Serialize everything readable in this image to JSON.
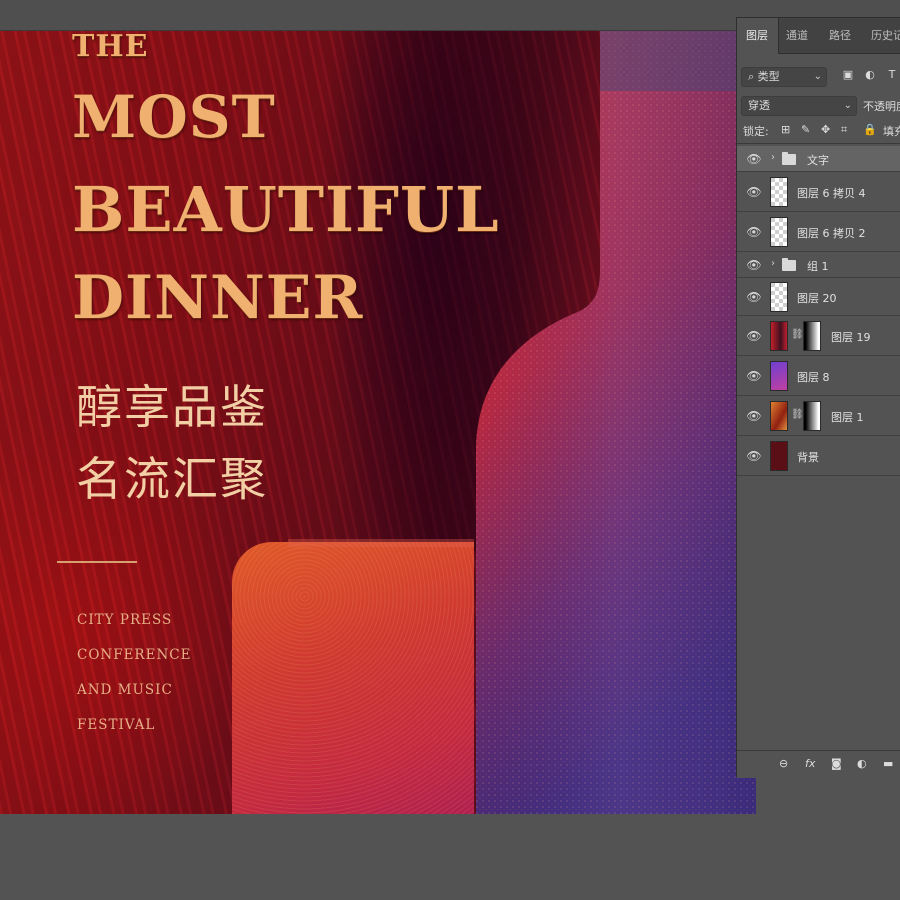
{
  "poster": {
    "title_line1": "THE",
    "title_line2": "MOST",
    "title_line3": "BEAUTIFUL",
    "title_line4": "DINNER",
    "chinese_line1": "醇享品鉴",
    "chinese_line2": "名流汇聚",
    "subtitle_lines": [
      "CITY PRESS",
      "CONFERENCE",
      "AND MUSIC",
      "FESTIVAL"
    ]
  },
  "layers_panel": {
    "tabs": [
      "图层",
      "通道",
      "路径",
      "历史记"
    ],
    "active_tab": "图层",
    "filter_kind": "类型",
    "filter_icons": [
      "image-filter-icon",
      "adjustment-filter-icon",
      "type-filter-icon"
    ],
    "type_filter_glyph": "T",
    "blend_mode": "穿透",
    "opacity_label": "不透明度",
    "lock_label": "锁定:",
    "fill_label": "填充",
    "layers": [
      {
        "name": "文字",
        "kind": "group",
        "selected": true
      },
      {
        "name": "图层 6 拷贝 4",
        "kind": "pixel"
      },
      {
        "name": "图层 6 拷贝 2",
        "kind": "pixel"
      },
      {
        "name": "组 1",
        "kind": "group"
      },
      {
        "name": "图层 20",
        "kind": "pixel"
      },
      {
        "name": "图层 19",
        "kind": "pixel-mask"
      },
      {
        "name": "图层 8",
        "kind": "pixel"
      },
      {
        "name": "图层 1",
        "kind": "pixel-mask"
      },
      {
        "name": "背景",
        "kind": "background"
      }
    ],
    "bottom_icons": [
      "link-icon",
      "fx-icon",
      "mask-icon",
      "adjustment-icon",
      "folder-icon",
      "new-layer-icon",
      "trash-icon"
    ],
    "fx_label": "fx"
  },
  "colors": {
    "workspace": "#535353",
    "poster_red": "#8a0f17",
    "gold": "#f0b070",
    "bottle": "#c42a3a",
    "selection": "#646464"
  }
}
